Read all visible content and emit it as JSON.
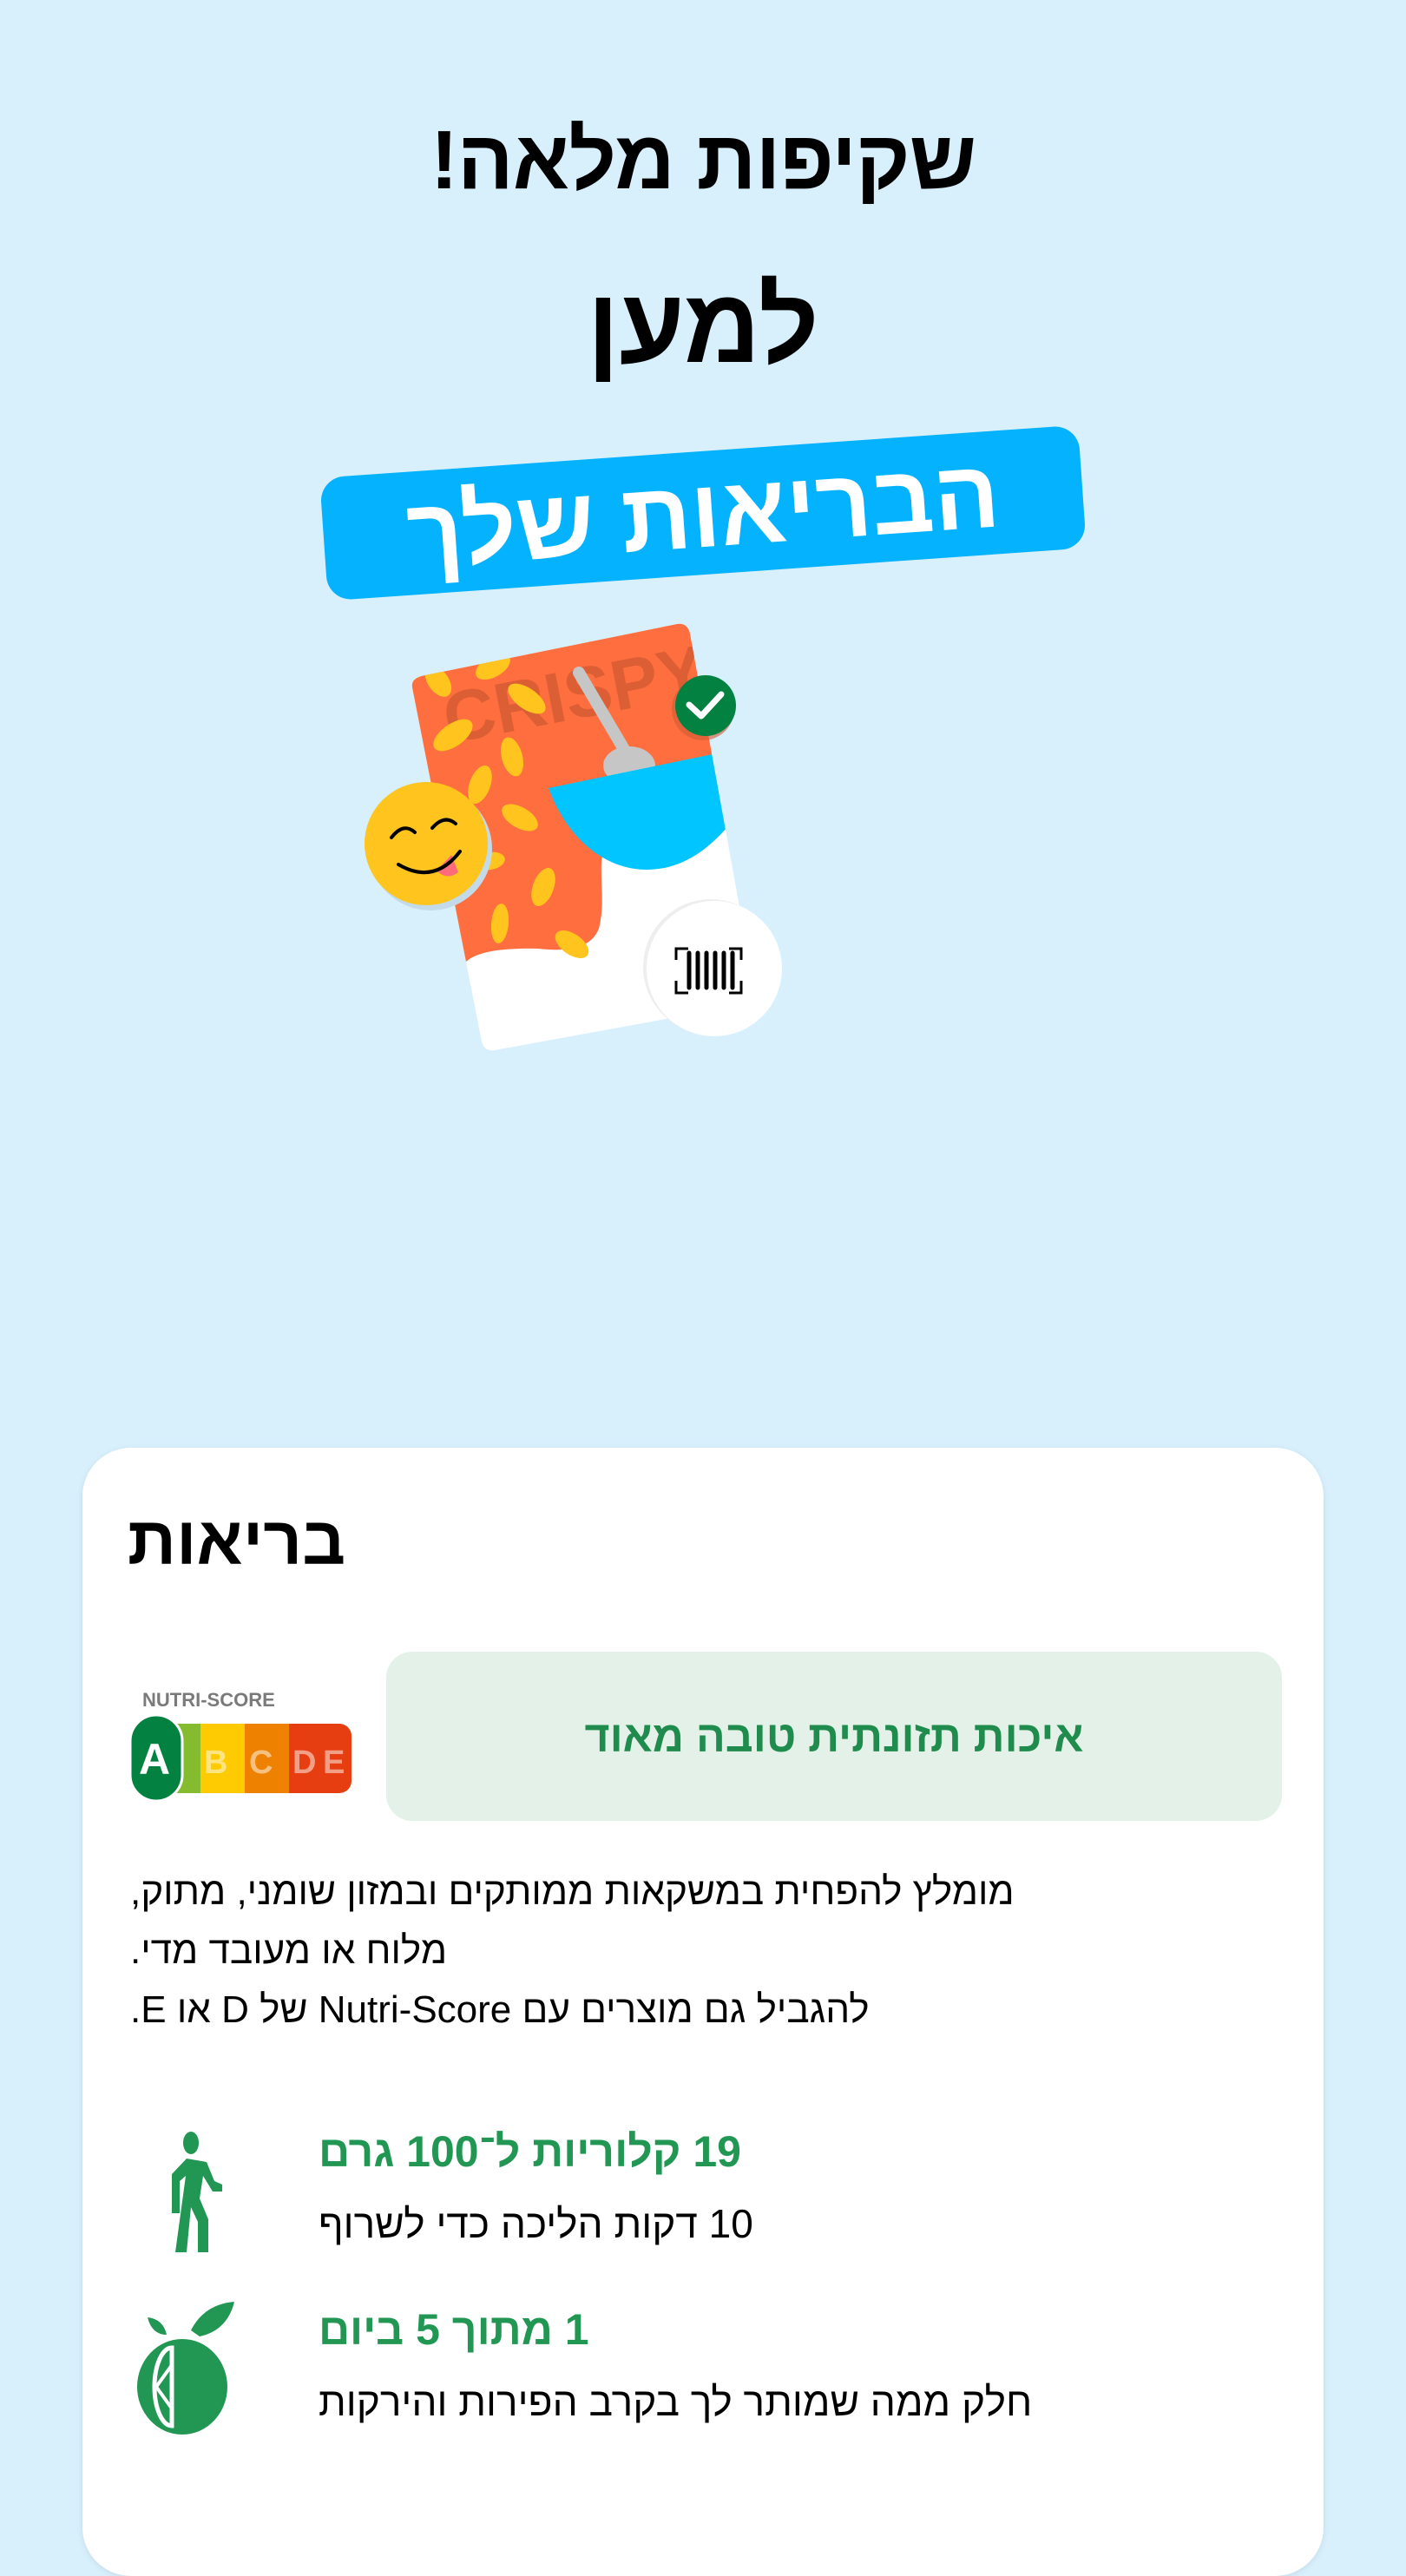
{
  "hero": {
    "line1": "שקיפות מלאה!",
    "line2": "למען",
    "tag": "הבריאות שלך",
    "tag_color": "#05b2fd"
  },
  "illustration": {
    "package_text": "CRISPY",
    "icons": [
      "smiley-tongue-icon",
      "check-circle-icon",
      "barcode-scan-icon",
      "spoon-icon"
    ]
  },
  "health_card": {
    "title": "בריאות",
    "nutri_score": {
      "label": "NUTRI-SCORE",
      "grades": [
        "A",
        "B",
        "C",
        "D",
        "E"
      ],
      "selected": "A",
      "colors": [
        "#038141",
        "#85bb2f",
        "#fecb02",
        "#ee8100",
        "#e63e11"
      ]
    },
    "quality_label": "איכות תזונתית טובה מאוד",
    "advice_lines": [
      "מומלץ להפחית במשקאות ממותקים ובמזון שומני, מתוק,",
      "מלוח או מעובד מדי.",
      "להגביל גם מוצרים עם Nutri-Score של D או E."
    ],
    "facts": [
      {
        "icon": "walking-person-icon",
        "title": "19 קלוריות ל־100 גרם",
        "subtitle": "10 דקות הליכה כדי לשרוף"
      },
      {
        "icon": "fruit-icon",
        "title": "1 מתוך 5 ביום",
        "subtitle": "חלק ממה שמותר לך בקרב הפירות והירקות"
      }
    ],
    "accent_color": "#229653"
  }
}
